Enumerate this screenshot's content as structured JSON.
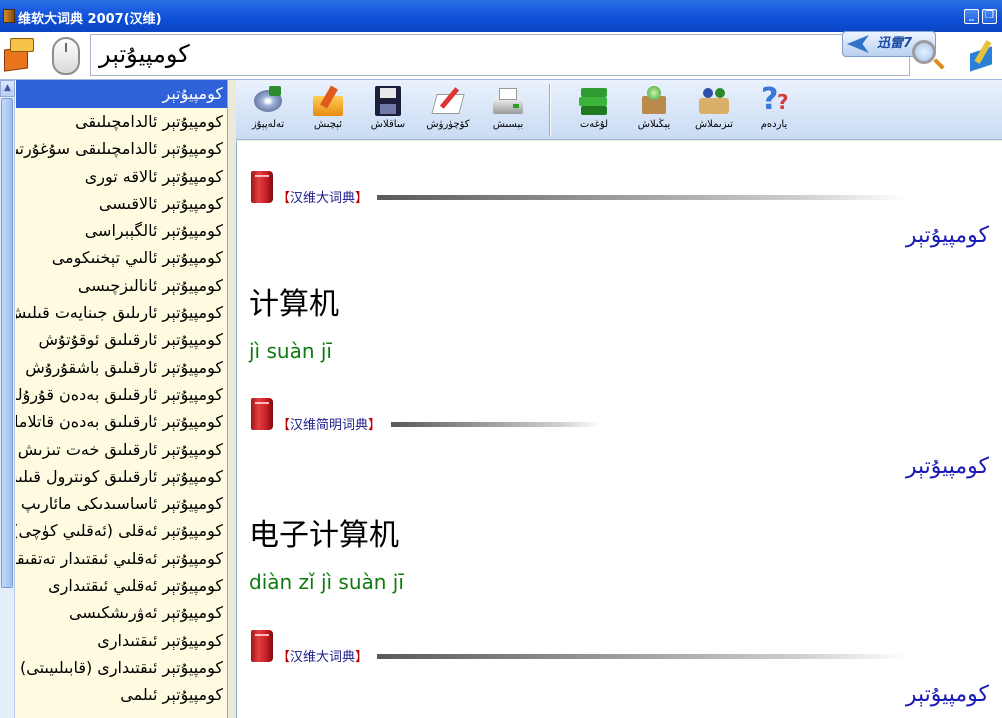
{
  "window": {
    "title": "维软大词典 2007(汉维)"
  },
  "search": {
    "value": "كومپيۇتېر",
    "xunlei_label": "迅雷7"
  },
  "toolbar": {
    "items": [
      {
        "label": "تەلەپپۇز",
        "icon": "speaker-disc-icon"
      },
      {
        "label": "ئېچىش",
        "icon": "open-folder-icon"
      },
      {
        "label": "ساقلاش",
        "icon": "floppy-save-icon"
      },
      {
        "label": "كۆچۈرۈش",
        "icon": "copy-notebook-icon"
      },
      {
        "label": "بېسىش",
        "icon": "printer-icon"
      },
      {
        "label": "لۇغەت",
        "icon": "books-icon"
      },
      {
        "label": "يېڭىلاش",
        "icon": "update-globe-icon"
      },
      {
        "label": "تىزىملاش",
        "icon": "register-users-icon"
      },
      {
        "label": "ياردەم",
        "icon": "help-question-icon"
      }
    ]
  },
  "wordlist": {
    "items": [
      "كومپيۇتېر",
      "كومپيۇتېر ئالدامچىلىقى",
      "كومپيۇتېر ئالدامچىلىقى سۇغۇرتىسى",
      "كومپيۇتېر ئالاقە تورى",
      "كومپيۇتېر ئالاقىسى",
      "كومپيۇتېر ئالگېبراسى",
      "كومپيۇتېر ئالىي تېخنىكومى",
      "كومپيۇتېر ئانالىزچىسى",
      "كومپيۇتېر ئارىلىق جىنايەت قىلىش",
      "كومپيۇتېر ئارقىلىق ئوقۇتۇش",
      "كومپيۇتېر ئارقىلىق باشقۇرۇش",
      "كومپيۇتېر ئارقىلىق بەدەن قۇرۇلمىسى",
      "كومپيۇتېر ئارقىلىق بەدەن قاتلاملىق",
      "كومپيۇتېر ئارقىلىق خەت تىزىش",
      "كومپيۇتېر ئارقىلىق كونترول قىلىش",
      "كومپيۇتېر ئاساسىدىكى مائارىپ",
      "كومپيۇتېر ئەقلى (ئەقلىي كۈچى)",
      "كومپيۇتېر ئەقلىي ئىقتىدار تەتقىقاتى",
      "كومپيۇتېر ئەقلىي ئىقتىدارى",
      "كومپيۇتېر ئەۋرىشكىسى",
      "كومپيۇتېر ئىقتىدارى",
      "كومپيۇتېر ئىقتىدارى (قابىلىيىتى)",
      "كومپيۇتېر ئىلمى"
    ]
  },
  "entries": [
    {
      "source": "汉维大词典",
      "ug": "كومپيۇتېر",
      "zh": "计算机",
      "pinyin": "jì suàn jī"
    },
    {
      "source": "汉维简明词典",
      "ug": "كومپيۇتېر",
      "zh": "电子计算机",
      "pinyin": "diàn zǐ jì suàn jī"
    },
    {
      "source": "汉维大词典",
      "ug": "كومپيۇتېر"
    }
  ]
}
